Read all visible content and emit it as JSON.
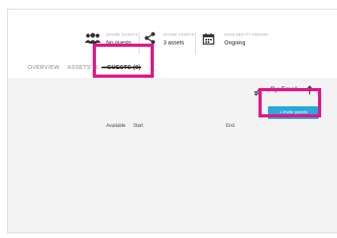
{
  "header": {
    "share_guests": {
      "caption": "SHARE GUESTS",
      "value": "No guests",
      "icon": "guests-icon"
    },
    "share_assets": {
      "caption": "SHARE ASSETS",
      "value": "3 assets",
      "icon": "share-icon"
    },
    "availability": {
      "caption": "AVAILABILITY PERIOD",
      "value": "Ongoing",
      "icon": "calendar-icon"
    }
  },
  "tabs": [
    {
      "label": "OVERVIEW"
    },
    {
      "label": "ASSETS (3"
    },
    {
      "label": "GUESTS (0)"
    }
  ],
  "toolbar": {
    "sort_label": "By: Email",
    "invite_label": "+ Invite guests"
  },
  "columns": [
    "Available",
    "Start",
    "End"
  ],
  "colors": {
    "accent": "#2aa7dc",
    "highlight": "#e0168c"
  }
}
